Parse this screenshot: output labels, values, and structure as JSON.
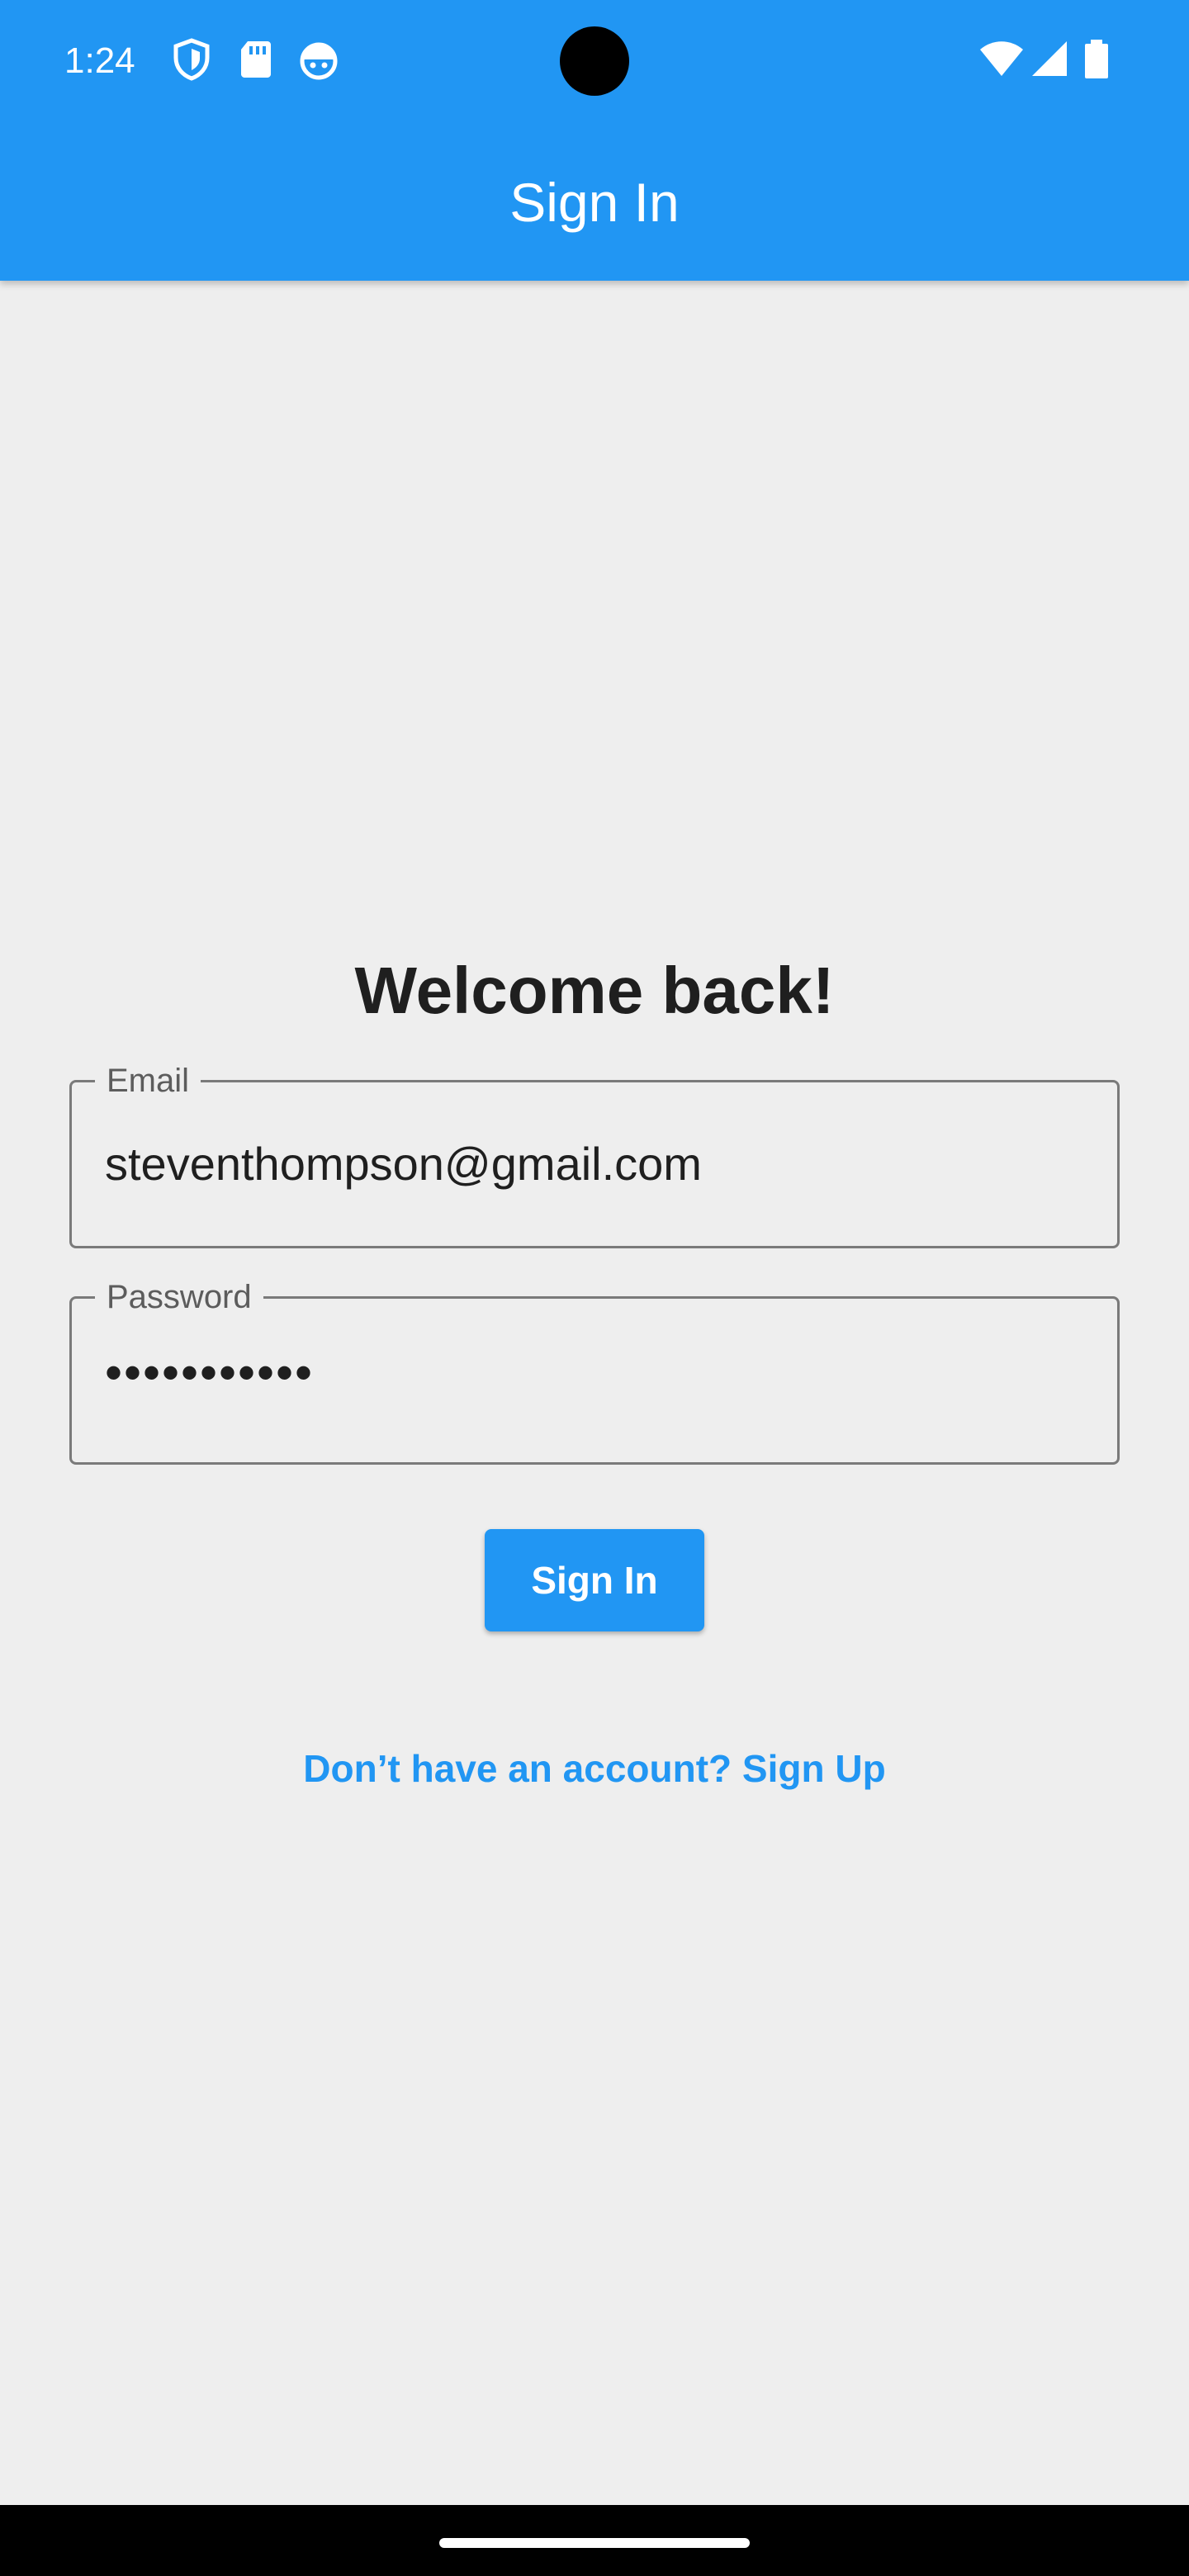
{
  "status_bar": {
    "time": "1:24",
    "left_icons": [
      "shield-icon",
      "sd-card-icon",
      "android-face-icon"
    ],
    "right_icons": [
      "wifi-icon",
      "signal-icon",
      "battery-icon"
    ]
  },
  "app_bar": {
    "title": "Sign In",
    "background_color": "#2196f3"
  },
  "form": {
    "heading": "Welcome back!",
    "email": {
      "label": "Email",
      "value": "steventhompson@gmail.com"
    },
    "password": {
      "label": "Password",
      "masked_value": "•••••••••••"
    },
    "submit_label": "Sign In",
    "signup_link": "Don’t have an account? Sign Up"
  },
  "colors": {
    "accent": "#2196f3",
    "background": "#eeeeee",
    "text": "#1f1f1f"
  }
}
